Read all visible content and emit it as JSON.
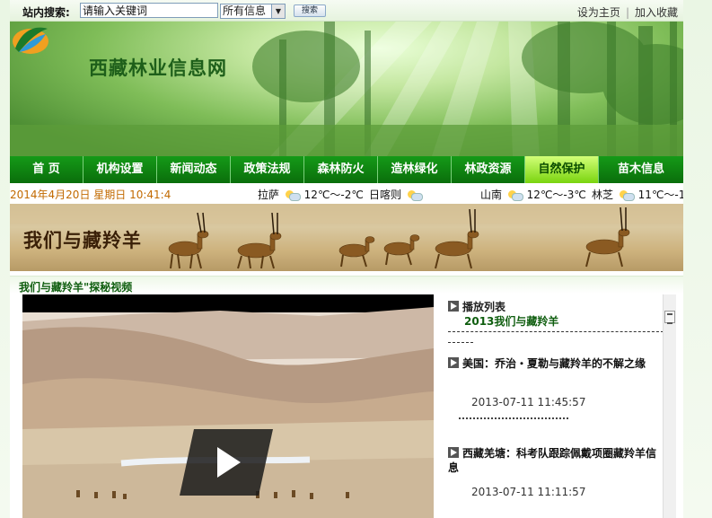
{
  "search": {
    "label": "站内搜索:",
    "placeholder": "请输入关键词",
    "scope": "所有信息",
    "button": "搜索"
  },
  "toplinks": [
    "设为主页",
    "加入收藏"
  ],
  "site": {
    "title": "西藏林业信息网"
  },
  "nav": [
    {
      "label": "首 页",
      "active": false
    },
    {
      "label": "机构设置",
      "active": false
    },
    {
      "label": "新闻动态",
      "active": false
    },
    {
      "label": "政策法规",
      "active": false
    },
    {
      "label": "森林防火",
      "active": false
    },
    {
      "label": "造林绿化",
      "active": false
    },
    {
      "label": "林政资源",
      "active": false
    },
    {
      "label": "自然保护",
      "active": true
    },
    {
      "label": "苗木信息",
      "active": false
    }
  ],
  "infobar": {
    "date": "2014年4月20日 星期日 10:41:4",
    "weather": [
      {
        "city": "拉萨",
        "temp": "12℃～-2℃",
        "icon": "partly-cloudy-icon"
      },
      {
        "city": "日喀则",
        "temp": "",
        "icon": "partly-cloudy-icon"
      },
      {
        "city": "山南",
        "temp": "12℃～-3℃",
        "icon": "partly-cloudy-icon"
      },
      {
        "city": "林芝",
        "temp": "11℃～-1",
        "icon": "partly-cloudy-icon"
      }
    ]
  },
  "feature": {
    "title": "我们与藏羚羊"
  },
  "section": {
    "title": "我们与藏羚羊\"探秘视频"
  },
  "playlist": {
    "heading": "播放列表",
    "subtitle": "2013我们与藏羚羊",
    "items": [
      {
        "title": "美国：乔治・夏勒与藏羚羊的不解之缘",
        "date": "2013-07-11 11:45:57"
      },
      {
        "title": "西藏羌塘：科考队跟踪佩戴项圈藏羚羊信息",
        "date": "2013-07-11 11:11:57"
      }
    ]
  },
  "colors": {
    "nav_bg": "#0f8a12",
    "nav_active": "#a6e83a",
    "date_text": "#c26a00",
    "brand_green": "#1e5f1a"
  }
}
